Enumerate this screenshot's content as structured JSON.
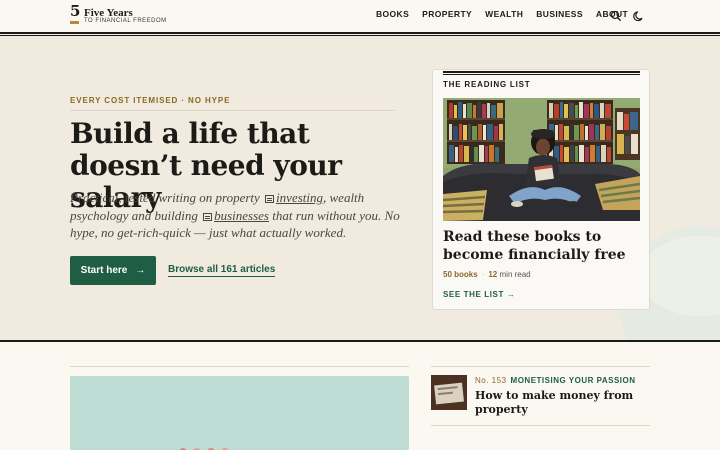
{
  "brand": {
    "mark": "5",
    "title": "Five Years",
    "subtitle": "TO FINANCIAL FREEDOM"
  },
  "nav": {
    "items": [
      "BOOKS",
      "PROPERTY",
      "WEALTH",
      "BUSINESS",
      "ABOUT"
    ]
  },
  "icons": {
    "search": "search-icon",
    "theme": "moon-icon",
    "arrow": "arrow-right-icon"
  },
  "hero": {
    "eyebrow": "EVERY COST ITEMISED · NO HYPE",
    "headline": "Build a life that doesn’t need your salary",
    "intro": {
      "part1": "Practical, tested writing on property ",
      "link1": "investing",
      "part2": ", wealth psychology and building ",
      "link2": "businesses",
      "part3": " that run without you. No hype, no get-rich-quick — just what actually worked."
    },
    "primary_cta": "Start here",
    "primary_cta_arrow": "→",
    "secondary_cta": "Browse all 161 articles"
  },
  "reading_list": {
    "eyebrow": "THE READING LIST",
    "title": "Read these books to become financially free",
    "books_count": "50 books",
    "read_time_num": "12",
    "read_time_label": "min read",
    "link": "SEE THE LIST →"
  },
  "latest_article": {
    "number": "No. 153",
    "category": "MONETISING YOUR PASSION",
    "title": "How to make money from property"
  },
  "colors": {
    "accent_green": "#1f5d45",
    "accent_gold": "#8a6a23",
    "ink": "#1d1b18",
    "hero_bg": "#f1ebdf"
  }
}
